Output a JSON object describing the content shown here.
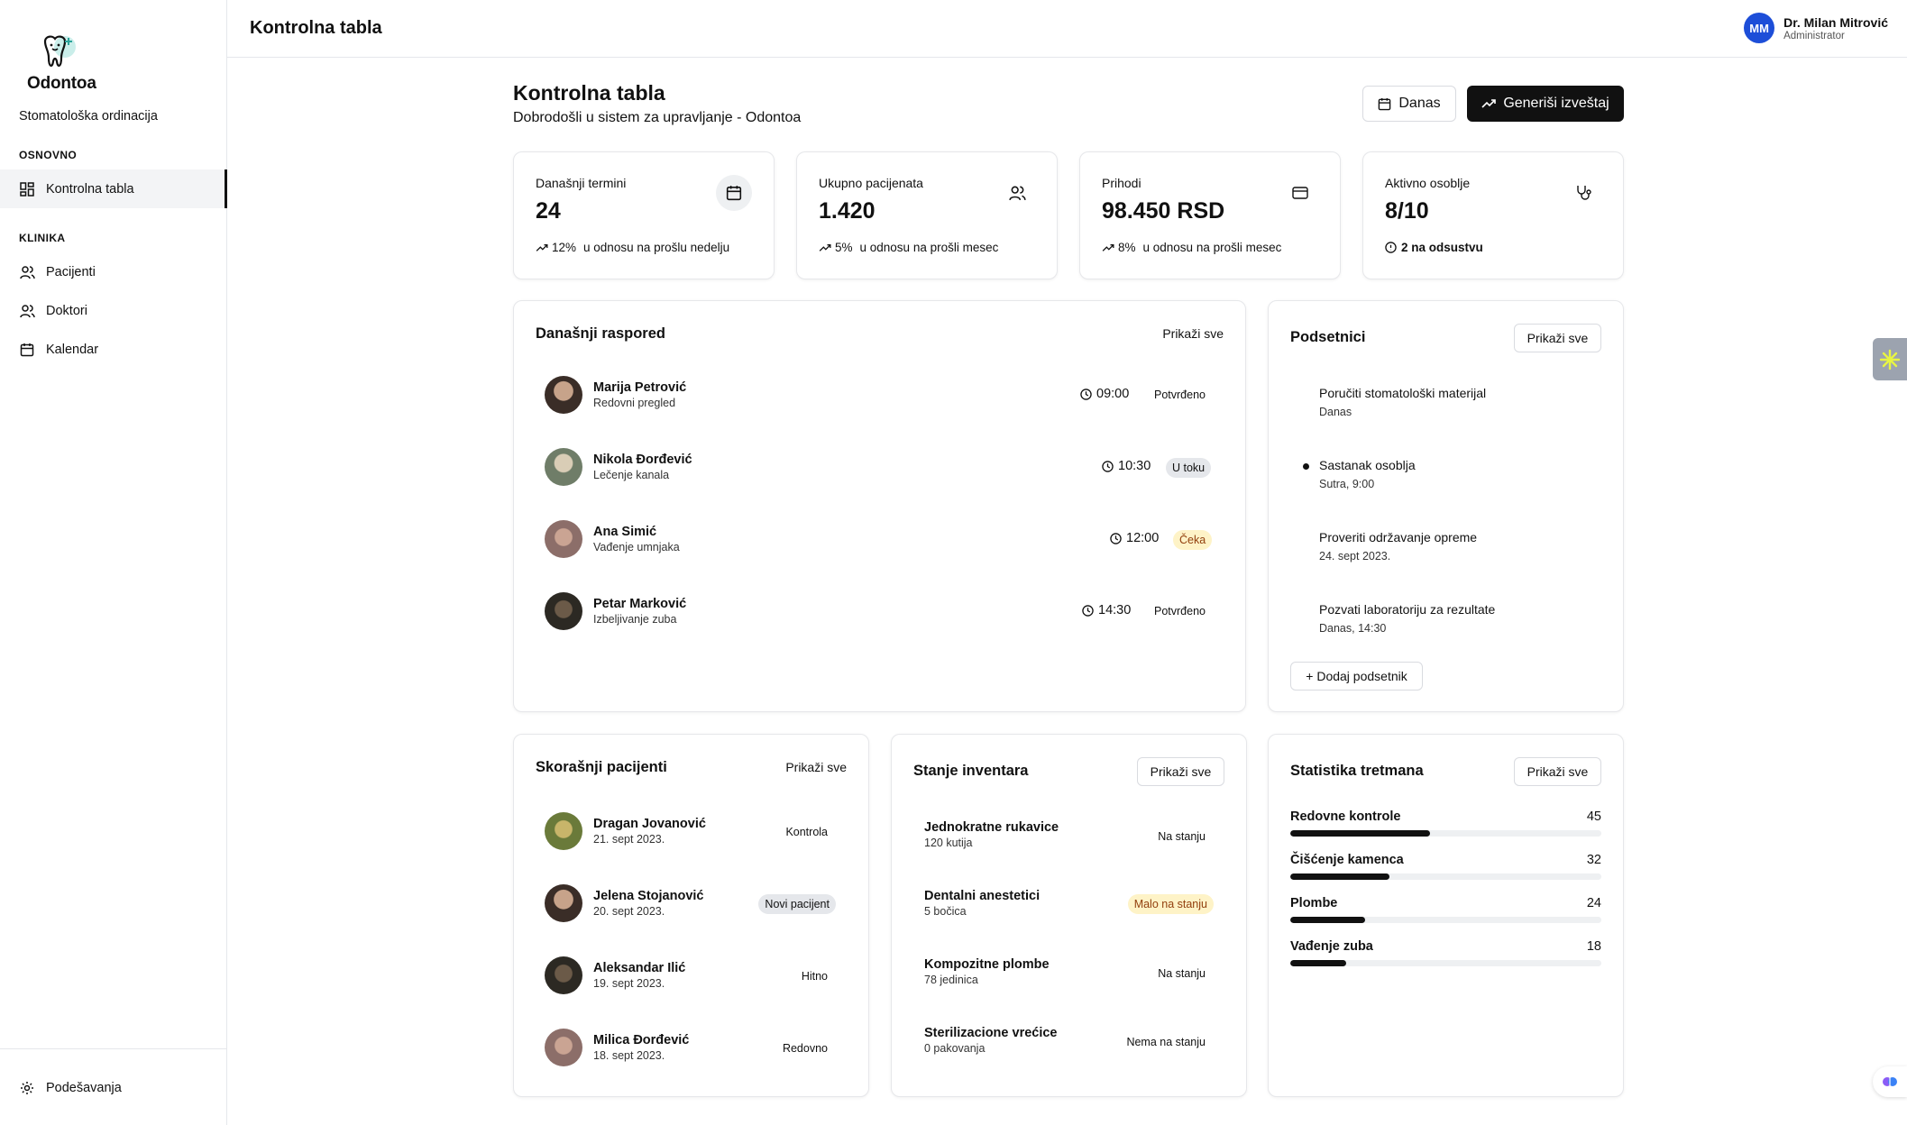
{
  "app": {
    "name": "Odontoa",
    "subtitle": "Stomatološka ordinacija"
  },
  "sidebar": {
    "section_main": "OSNOVNO",
    "section_clinic": "KLINIKA",
    "items": [
      {
        "label": "Kontrolna tabla",
        "icon": "dashboard-icon"
      },
      {
        "label": "Pacijenti",
        "icon": "users-icon"
      },
      {
        "label": "Doktori",
        "icon": "users-icon"
      },
      {
        "label": "Kalendar",
        "icon": "calendar-icon"
      }
    ],
    "settings": "Podešavanja"
  },
  "header": {
    "title": "Kontrolna tabla",
    "user": {
      "initials": "MM",
      "name": "Dr. Milan Mitrović",
      "role": "Administrator"
    }
  },
  "page": {
    "title": "Kontrolna tabla",
    "subtitle": "Dobrodošli u sistem za upravljanje - Odontoa",
    "btn_today": "Danas",
    "btn_report": "Generiši izveštaj"
  },
  "stats": [
    {
      "label": "Današnji termini",
      "value": "24",
      "change": "12%",
      "note": "u odnosu na prošlu nedelju",
      "icon": "calendar-icon"
    },
    {
      "label": "Ukupno pacijenata",
      "value": "1.420",
      "change": "5%",
      "note": "u odnosu na prošli mesec",
      "icon": "users-icon"
    },
    {
      "label": "Prihodi",
      "value": "98.450 RSD",
      "change": "8%",
      "note": "u odnosu na prošli mesec",
      "icon": "credit-card-icon"
    },
    {
      "label": "Aktivno osoblje",
      "value": "8/10",
      "note": "2 na odsustvu",
      "icon": "stethoscope-icon"
    }
  ],
  "schedule": {
    "title": "Današnji raspored",
    "show_all": "Prikaži sve",
    "items": [
      {
        "name": "Marija Petrović",
        "treatment": "Redovni pregled",
        "time": "09:00",
        "status": "Potvrđeno"
      },
      {
        "name": "Nikola Đorđević",
        "treatment": "Lečenje kanala",
        "time": "10:30",
        "status": "U toku"
      },
      {
        "name": "Ana Simić",
        "treatment": "Vađenje umnjaka",
        "time": "12:00",
        "status": "Čeka"
      },
      {
        "name": "Petar Marković",
        "treatment": "Izbeljivanje zuba",
        "time": "14:30",
        "status": "Potvrđeno"
      }
    ]
  },
  "reminders": {
    "title": "Podsetnici",
    "show_all": "Prikaži sve",
    "items": [
      {
        "title": "Poručiti stomatološki materijal",
        "date": "Danas"
      },
      {
        "title": "Sastanak osoblja",
        "date": "Sutra, 9:00"
      },
      {
        "title": "Proveriti održavanje opreme",
        "date": "24. sept 2023."
      },
      {
        "title": "Pozvati laboratoriju za rezultate",
        "date": "Danas, 14:30"
      }
    ],
    "add": "+ Dodaj podsetnik"
  },
  "recent_patients": {
    "title": "Skorašnji pacijenti",
    "show_all": "Prikaži sve",
    "items": [
      {
        "name": "Dragan Jovanović",
        "date": "21. sept 2023.",
        "tag": "Kontrola"
      },
      {
        "name": "Jelena Stojanović",
        "date": "20. sept 2023.",
        "tag": "Novi pacijent"
      },
      {
        "name": "Aleksandar Ilić",
        "date": "19. sept 2023.",
        "tag": "Hitno"
      },
      {
        "name": "Milica Đorđević",
        "date": "18. sept 2023.",
        "tag": "Redovno"
      }
    ]
  },
  "inventory": {
    "title": "Stanje inventara",
    "show_all": "Prikaži sve",
    "items": [
      {
        "name": "Jednokratne rukavice",
        "qty": "120 kutija",
        "status": "Na stanju"
      },
      {
        "name": "Dentalni anestetici",
        "qty": "5 bočica",
        "status": "Malo na stanju"
      },
      {
        "name": "Kompozitne plombe",
        "qty": "78 jedinica",
        "status": "Na stanju"
      },
      {
        "name": "Sterilizacione vrećice",
        "qty": "0 pakovanja",
        "status": "Nema na stanju"
      }
    ]
  },
  "treatments": {
    "title": "Statistika tretmana",
    "show_all": "Prikaži sve",
    "max": 100,
    "items": [
      {
        "name": "Redovne kontrole",
        "value": 45
      },
      {
        "name": "Čišćenje kamenca",
        "value": 32
      },
      {
        "name": "Plombe",
        "value": 24
      },
      {
        "name": "Vađenje zuba",
        "value": 18
      }
    ]
  },
  "colors": {
    "accent": "#111111",
    "avatar_bg": "#1d4ed8",
    "badge_yellow": "#fef3c7",
    "badge_gray": "#e5e7eb"
  }
}
